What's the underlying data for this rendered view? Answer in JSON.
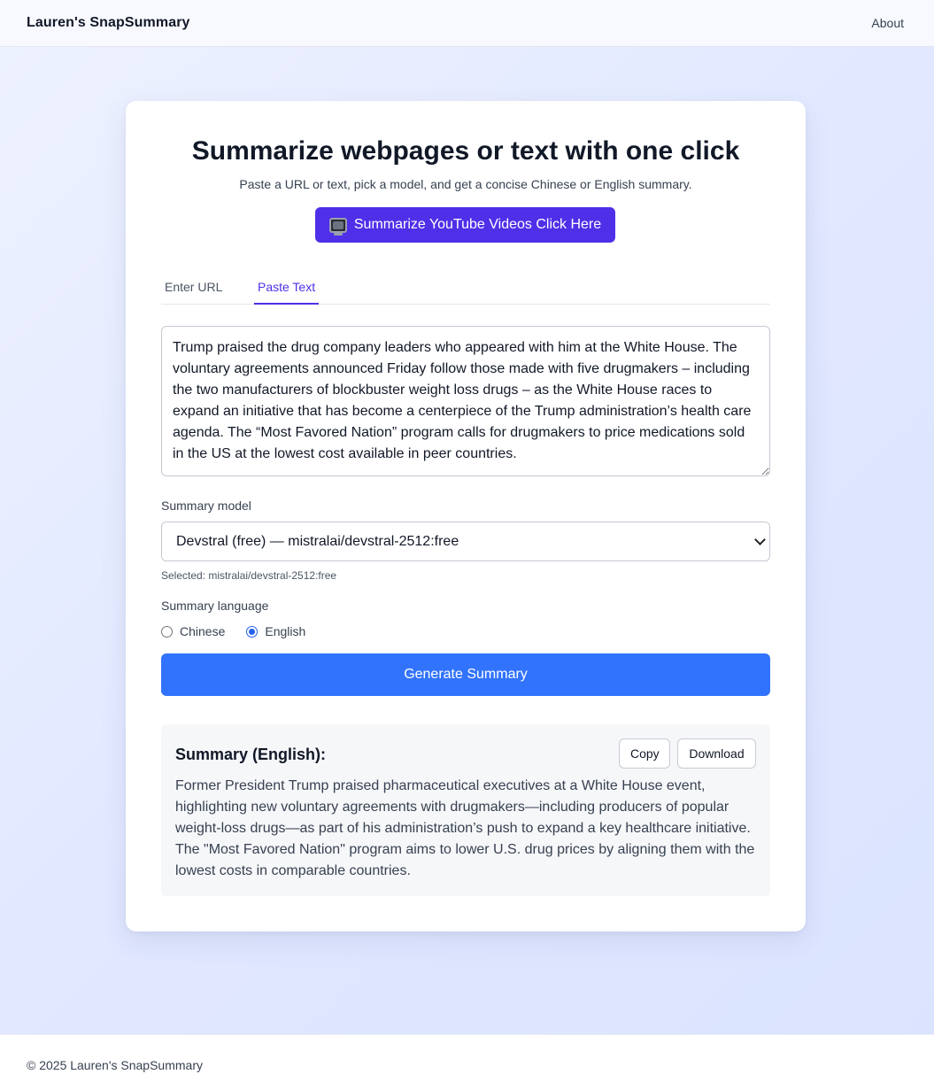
{
  "header": {
    "brand": "Lauren's SnapSummary",
    "about_link": "About"
  },
  "hero": {
    "title": "Summarize webpages or text with one click",
    "subtitle": "Paste a URL or text, pick a model, and get a concise Chinese or English summary.",
    "youtube_button": "Summarize YouTube Videos Click Here",
    "youtube_button_icon": "tv-icon"
  },
  "tabs": [
    {
      "label": "Enter URL",
      "active": false
    },
    {
      "label": "Paste Text",
      "active": true
    }
  ],
  "input": {
    "text": "Trump praised the drug company leaders who appeared with him at the White House. The voluntary agreements announced Friday follow those made with five drugmakers – including the two manufacturers of blockbuster weight loss drugs – as the White House races to expand an initiative that has become a centerpiece of the Trump administration’s health care agenda. The “Most Favored Nation” program calls for drugmakers to price medications sold in the US at the lowest cost available in peer countries."
  },
  "model": {
    "label": "Summary model",
    "selected_option": "Devstral (free) — mistralai/devstral-2512:free",
    "selected_note": "Selected: mistralai/devstral-2512:free"
  },
  "language": {
    "label": "Summary language",
    "options": [
      {
        "label": "Chinese",
        "checked": false
      },
      {
        "label": "English",
        "checked": true
      }
    ]
  },
  "generate_button": "Generate Summary",
  "summary": {
    "title": "Summary (English):",
    "copy_label": "Copy",
    "download_label": "Download",
    "text": "Former President Trump praised pharmaceutical executives at a White House event, highlighting new voluntary agreements with drugmakers—including producers of popular weight-loss drugs—as part of his administration’s push to expand a key healthcare initiative. The \"Most Favored Nation\" program aims to lower U.S. drug prices by aligning them with the lowest costs in comparable countries."
  },
  "footer": {
    "text": "© 2025 Lauren's SnapSummary"
  },
  "colors": {
    "primary_purple": "#4f2fe8",
    "primary_blue": "#3173fc",
    "background": "#e0e7ff"
  }
}
